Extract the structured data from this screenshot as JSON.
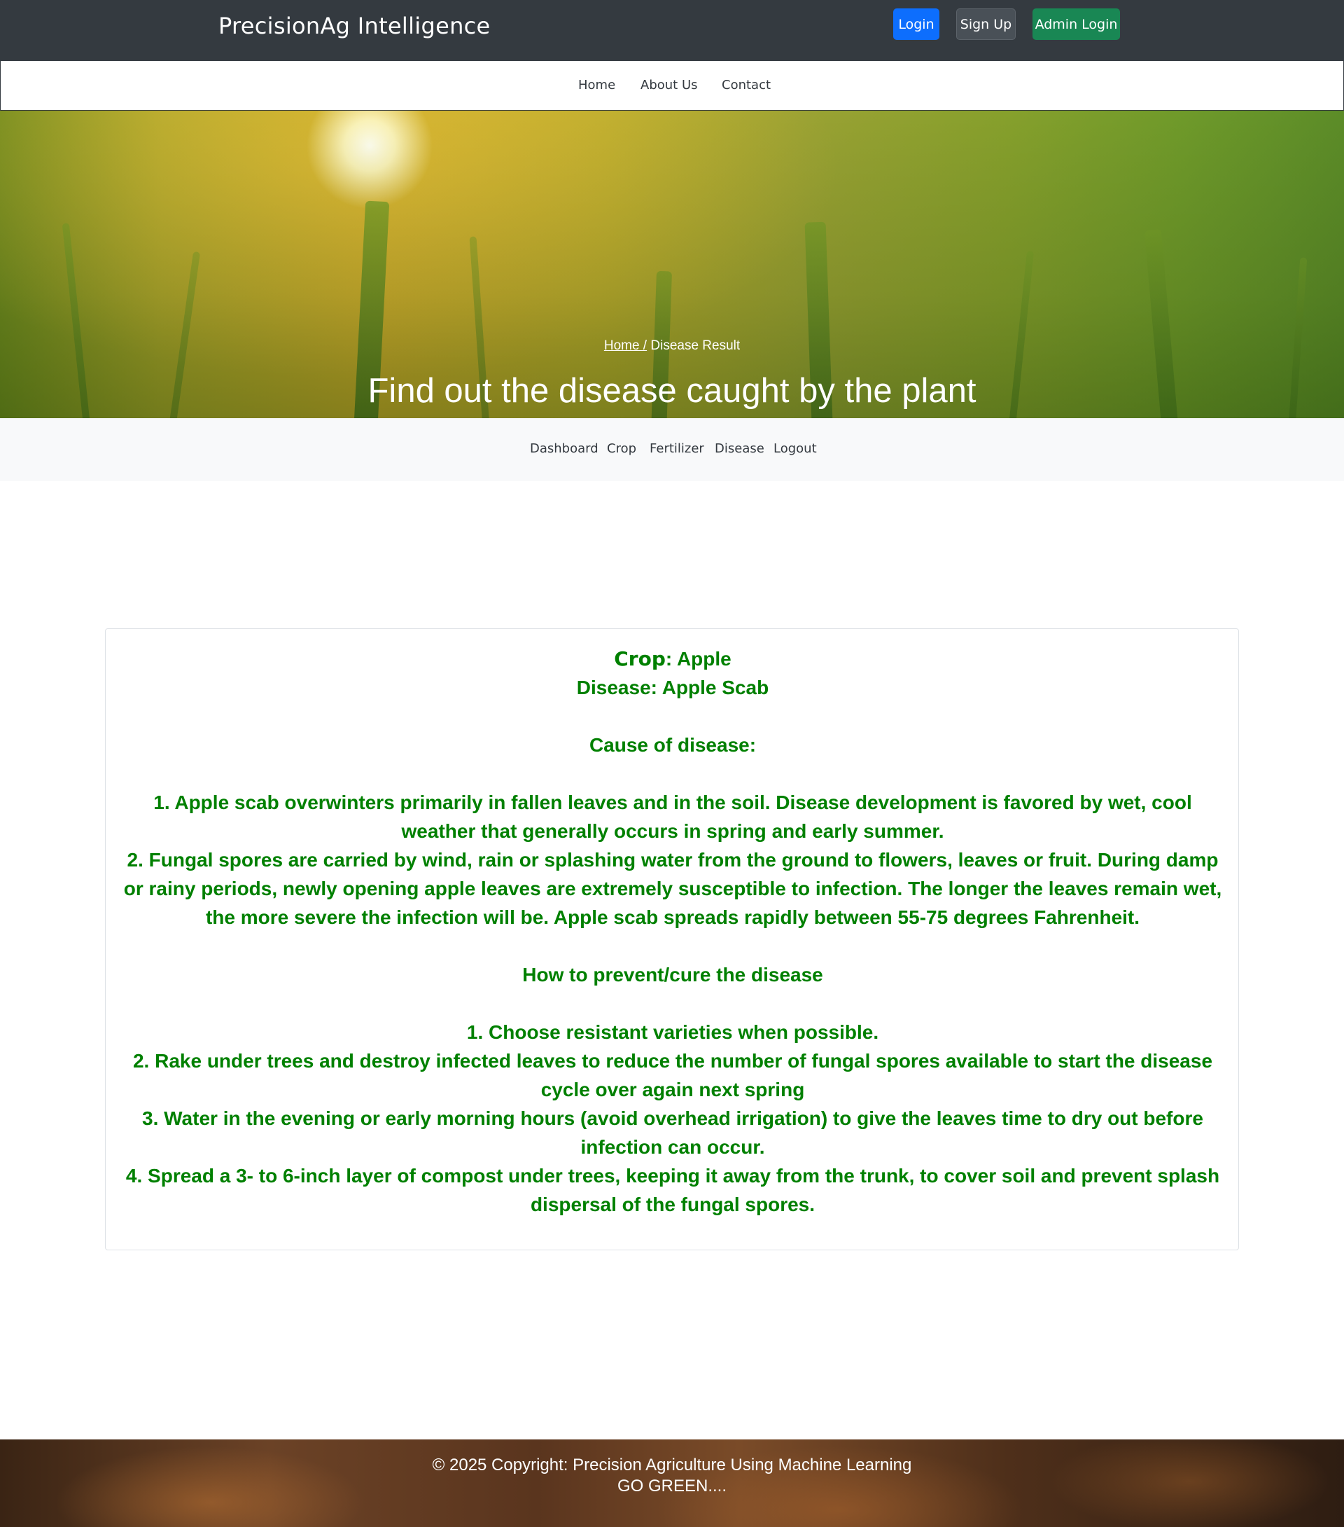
{
  "header": {
    "brand": "PrecisionAg Intelligence",
    "login_label": "Login",
    "signup_label": "Sign Up",
    "admin_login_label": "Admin Login"
  },
  "nav": {
    "home": "Home",
    "about": "About Us",
    "contact": "Contact"
  },
  "hero": {
    "breadcrumb_home": "Home /",
    "breadcrumb_current": " Disease Result",
    "title": "Find out the disease caught by the plant"
  },
  "subnav": {
    "dashboard": "Dashboard",
    "crop": "Crop",
    "fertilizer": "Fertilizer",
    "disease": "Disease",
    "logout": "Logout"
  },
  "result": {
    "crop_label": "Crop",
    "crop_value": ": Apple",
    "disease_line": "Disease: Apple Scab",
    "cause_heading": "Cause of disease:",
    "causes": [
      "1. Apple scab overwinters primarily in fallen leaves and in the soil. Disease development is favored by wet, cool weather that generally occurs in spring and early summer.",
      "2. Fungal spores are carried by wind, rain or splashing water from the ground to flowers, leaves or fruit. During damp or rainy periods, newly opening apple leaves are extremely susceptible to infection. The longer the leaves remain wet, the more severe the infection will be. Apple scab spreads rapidly between 55-75 degrees Fahrenheit."
    ],
    "prevent_heading": "How to prevent/cure the disease",
    "prevention": [
      "1. Choose resistant varieties when possible.",
      "2. Rake under trees and destroy infected leaves to reduce the number of fungal spores available to start the disease cycle over again next spring",
      "3. Water in the evening or early morning hours (avoid overhead irrigation) to give the leaves time to dry out before infection can occur.",
      "4. Spread a 3- to 6-inch layer of compost under trees, keeping it away from the trunk, to cover soil and prevent splash dispersal of the fungal spores."
    ]
  },
  "footer": {
    "copyright": "© 2025 Copyright: Precision Agriculture Using Machine Learning",
    "slogan": "GO GREEN...."
  },
  "colors": {
    "topbar": "#343a40",
    "login_button": "#0d6efd",
    "signup_button": "#495057",
    "admin_button": "#198754",
    "result_text": "#008000",
    "subnav_bg": "#f8f9fa"
  }
}
